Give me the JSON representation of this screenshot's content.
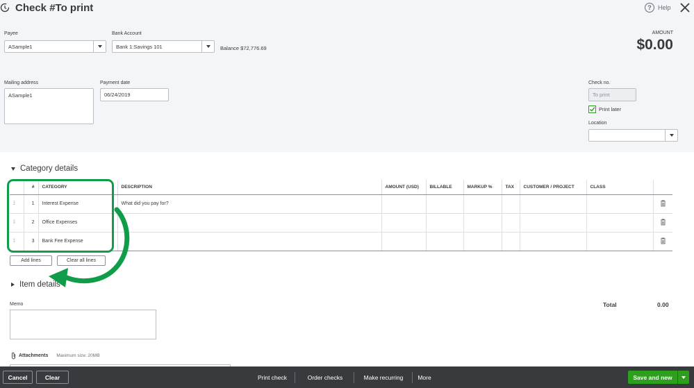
{
  "header": {
    "title": "Check #To print",
    "help_label": "Help",
    "history_icon": "history-icon",
    "close_icon": "close-icon"
  },
  "payee": {
    "label": "Payee",
    "value": "ASample1"
  },
  "bank_account": {
    "label": "Bank Account",
    "value": "Bank 1:Savings 101",
    "balance": "Balance $72,776.69"
  },
  "amount": {
    "label": "AMOUNT",
    "value": "$0.00"
  },
  "mailing_address": {
    "label": "Mailing address",
    "value": "ASample1"
  },
  "payment_date": {
    "label": "Payment date",
    "value": "06/24/2019"
  },
  "check_no": {
    "label": "Check no.",
    "value": "To print"
  },
  "print_later": {
    "label": "Print later",
    "checked": true
  },
  "location": {
    "label": "Location",
    "value": ""
  },
  "category_details": {
    "title": "Category details",
    "columns": [
      "#",
      "CATEGORY",
      "DESCRIPTION",
      "AMOUNT (USD)",
      "BILLABLE",
      "MARKUP %",
      "TAX",
      "CUSTOMER / PROJECT",
      "CLASS"
    ],
    "rows": [
      {
        "num": "1",
        "category": "Interest Expense",
        "description": "",
        "description_placeholder": "What did you pay for?"
      },
      {
        "num": "2",
        "category": "Office Expenses",
        "description": ""
      },
      {
        "num": "3",
        "category": "Bank Fee Expense",
        "description": ""
      }
    ],
    "add_lines": "Add lines",
    "clear_all_lines": "Clear all lines"
  },
  "item_details": {
    "title": "Item details"
  },
  "memo": {
    "label": "Memo",
    "value": ""
  },
  "total": {
    "label": "Total",
    "value": "0.00"
  },
  "attachments": {
    "label": "Attachments",
    "max_size": "Maximum size: 20MB"
  },
  "footer": {
    "cancel": "Cancel",
    "clear": "Clear",
    "print_check": "Print check",
    "order_checks": "Order checks",
    "make_recurring": "Make recurring",
    "more": "More",
    "save_and_new": "Save and new"
  },
  "colors": {
    "accent_green": "#2ca01c",
    "annotation_green": "#0f9d4a",
    "footer_bg": "#393a3d"
  }
}
